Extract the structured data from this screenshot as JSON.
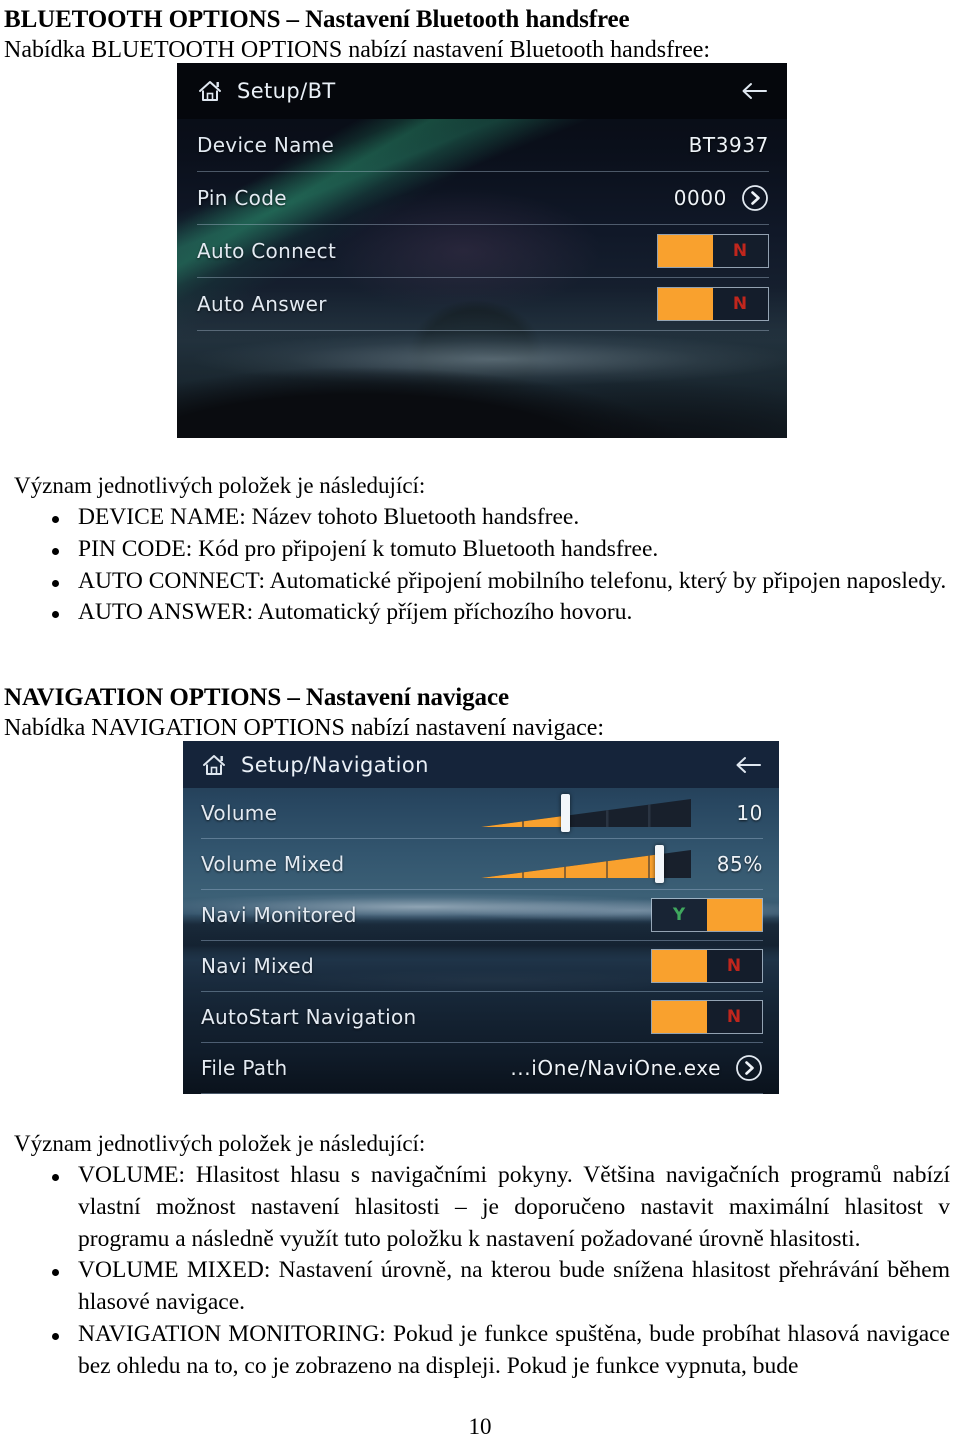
{
  "document": {
    "section1": {
      "heading": "BLUETOOTH OPTIONS – Nastavení Bluetooth handsfree",
      "intro": "Nabídka BLUETOOTH OPTIONS nabízí nastavení Bluetooth handsfree:",
      "lead": "Význam jednotlivých položek je následující:",
      "bullets": [
        "DEVICE NAME: Název tohoto Bluetooth handsfree.",
        "PIN CODE: Kód pro připojení k tomuto Bluetooth handsfree.",
        "AUTO CONNECT: Automatické připojení mobilního telefonu, který by připojen naposledy.",
        "AUTO ANSWER: Automatický příjem příchozího hovoru."
      ]
    },
    "section2": {
      "heading": "NAVIGATION OPTIONS – Nastavení navigace",
      "intro": "Nabídka NAVIGATION OPTIONS nabízí nastavení navigace:",
      "lead": "Význam jednotlivých položek je následující:",
      "bullets": [
        "VOLUME: Hlasitost hlasu s navigačními pokyny. Většina navigačních programů nabízí vlastní možnost nastavení hlasitosti – je doporučeno nastavit maximální hlasitost v programu a následně využít tuto položku k nastavení požadované úrovně hlasitosti.",
        "VOLUME MIXED: Nastavení úrovně, na kterou bude snížena hlasitost přehrávání během hlasové navigace.",
        "NAVIGATION MONITORING: Pokud je funkce spuštěna, bude probíhat hlasová navigace bez ohledu na to, co je zobrazeno na displeji. Pokud je funkce vypnuta, bude"
      ]
    },
    "page_number": "10"
  },
  "screen_bt": {
    "title": "Setup/BT",
    "home_icon": "home-icon",
    "back_icon": "back-arrow-icon",
    "rows": [
      {
        "label": "Device Name",
        "value": "BT3937",
        "type": "value"
      },
      {
        "label": "Pin Code",
        "value": "0000",
        "type": "value-arrow",
        "arrow_icon": "chevron-right-circle-icon"
      },
      {
        "label": "Auto Connect",
        "toggle": "N",
        "type": "toggle"
      },
      {
        "label": "Auto Answer",
        "toggle": "N",
        "type": "toggle"
      }
    ]
  },
  "screen_nav": {
    "title": "Setup/Navigation",
    "home_icon": "home-icon",
    "back_icon": "back-arrow-icon",
    "rows": [
      {
        "label": "Volume",
        "value": "10",
        "type": "slider",
        "fill_percent": 40
      },
      {
        "label": "Volume Mixed",
        "value": "85%",
        "type": "slider",
        "fill_percent": 85
      },
      {
        "label": "Navi Monitored",
        "toggle": "Y",
        "type": "toggle"
      },
      {
        "label": "Navi Mixed",
        "toggle": "N",
        "type": "toggle"
      },
      {
        "label": "AutoStart Navigation",
        "toggle": "N",
        "type": "toggle"
      },
      {
        "label": "File Path",
        "value": "...iOne/NaviOne.exe",
        "type": "value-arrow",
        "arrow_icon": "chevron-right-circle-icon"
      }
    ]
  },
  "colors": {
    "accent_orange": "#f9a12e",
    "toggle_no_red": "#c0261d",
    "toggle_yes_green": "#3fa85e",
    "screen_text": "#e8eef5"
  }
}
